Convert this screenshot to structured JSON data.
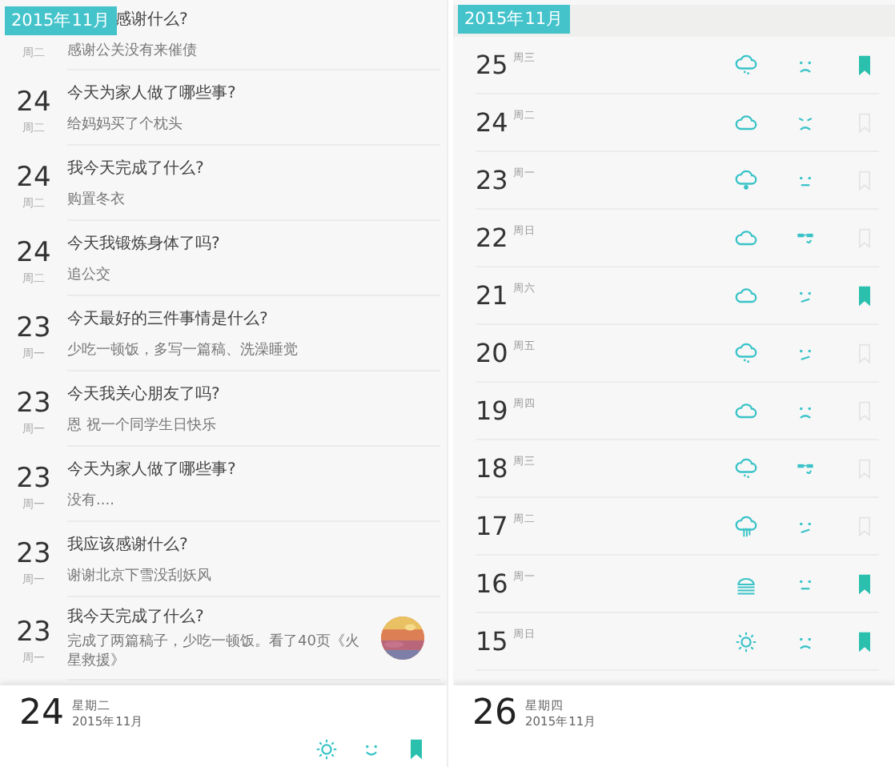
{
  "diary": {
    "month_badge": "2015年11月",
    "entries": [
      {
        "kind": "clipped",
        "weekday": "周二",
        "title": "感谢什么?",
        "body": "感谢公关没有来催债"
      },
      {
        "kind": "entry",
        "day": "24",
        "weekday": "周二",
        "title": "今天为家人做了哪些事?",
        "body": "给妈妈买了个枕头"
      },
      {
        "kind": "entry",
        "day": "24",
        "weekday": "周二",
        "title": "我今天完成了什么?",
        "body": "购置冬衣"
      },
      {
        "kind": "entry",
        "day": "24",
        "weekday": "周二",
        "title": "今天我锻炼身体了吗?",
        "body": "追公交"
      },
      {
        "kind": "entry",
        "day": "23",
        "weekday": "周一",
        "title": "今天最好的三件事情是什么?",
        "body": "少吃一顿饭，多写一篇稿、洗澡睡觉"
      },
      {
        "kind": "entry",
        "day": "23",
        "weekday": "周一",
        "title": "今天我关心朋友了吗?",
        "body": "恩 祝一个同学生日快乐"
      },
      {
        "kind": "entry",
        "day": "23",
        "weekday": "周一",
        "title": "今天为家人做了哪些事?",
        "body": "没有...."
      },
      {
        "kind": "entry",
        "day": "23",
        "weekday": "周一",
        "title": "我应该感谢什么?",
        "body": "谢谢北京下雪没刮妖风"
      },
      {
        "day": "23",
        "weekday": "周一",
        "title": "我今天完成了什么?",
        "body": "完成了两篇稿子，少吃一顿饭。看了40页《火星救援》"
      }
    ],
    "footer": {
      "day": "24",
      "weekday": "星期二",
      "month": "2015年11月",
      "icons": [
        {
          "kind": "sun"
        },
        {
          "kind": "smile"
        },
        {
          "kind": "bookmark"
        }
      ]
    }
  },
  "calendar": {
    "month_badge": "2015年11月",
    "days": [
      {
        "day": "25",
        "weekday": "周三",
        "weather": {
          "kind": "drizzle"
        },
        "mood": {
          "kind": "sad"
        },
        "bookmarked": true
      },
      {
        "day": "24",
        "weekday": "周二",
        "weather": {
          "kind": "cloud"
        },
        "mood": {
          "kind": "angry"
        },
        "bookmarked": false
      },
      {
        "day": "23",
        "weekday": "周一",
        "weather": {
          "kind": "snow"
        },
        "mood": {
          "kind": "neutral"
        },
        "bookmarked": false
      },
      {
        "day": "22",
        "weekday": "周日",
        "weather": {
          "kind": "cloud"
        },
        "mood": {
          "kind": "cool"
        },
        "bookmarked": false
      },
      {
        "day": "21",
        "weekday": "周六",
        "weather": {
          "kind": "cloud"
        },
        "mood": {
          "kind": "smirk"
        },
        "bookmarked": true
      },
      {
        "day": "20",
        "weekday": "周五",
        "weather": {
          "kind": "drizzle"
        },
        "mood": {
          "kind": "smirk"
        },
        "bookmarked": false
      },
      {
        "day": "19",
        "weekday": "周四",
        "weather": {
          "kind": "cloud"
        },
        "mood": {
          "kind": "sad"
        },
        "bookmarked": false
      },
      {
        "day": "18",
        "weekday": "周三",
        "weather": {
          "kind": "drizzle"
        },
        "mood": {
          "kind": "cool"
        },
        "bookmarked": false
      },
      {
        "day": "17",
        "weekday": "周二",
        "weather": {
          "kind": "rain"
        },
        "mood": {
          "kind": "smirk"
        },
        "bookmarked": false
      },
      {
        "day": "16",
        "weekday": "周一",
        "weather": {
          "kind": "fog"
        },
        "mood": {
          "kind": "neutral"
        },
        "bookmarked": true
      },
      {
        "day": "15",
        "weekday": "周日",
        "weather": {
          "kind": "sun"
        },
        "mood": {
          "kind": "sad"
        },
        "bookmarked": true
      }
    ],
    "footer": {
      "day": "26",
      "weekday": "星期四",
      "month": "2015年11月"
    }
  }
}
